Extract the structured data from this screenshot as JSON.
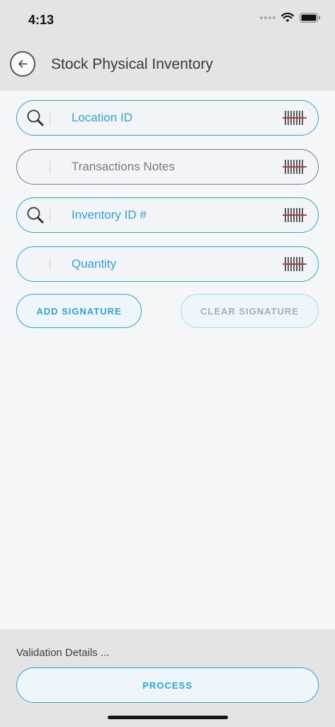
{
  "status_bar": {
    "time": "4:13",
    "icons": [
      "signal-icon",
      "wifi-icon",
      "battery-icon"
    ]
  },
  "header": {
    "title": "Stock Physical Inventory",
    "back_icon": "back-arrow-icon"
  },
  "fields": [
    {
      "label": "Location ID",
      "has_search": true,
      "style": "active"
    },
    {
      "label": "Transactions Notes",
      "has_search": false,
      "style": "inactive"
    },
    {
      "label": "Inventory ID #",
      "has_search": true,
      "style": "active"
    },
    {
      "label": "Quantity",
      "has_search": false,
      "style": "active"
    }
  ],
  "signature": {
    "add_label": "ADD SIGNATURE",
    "clear_label": "CLEAR SIGNATURE"
  },
  "footer": {
    "validation_text": "Validation Details ...",
    "process_label": "PROCESS"
  },
  "colors": {
    "accent": "#2aa7d8",
    "barcode_line": "#c0272d",
    "header_bg": "#e4e4e4",
    "body_bg": "#f5f6f8"
  }
}
